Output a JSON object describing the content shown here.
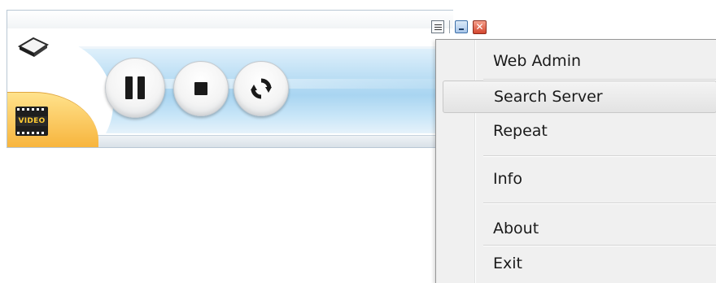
{
  "player": {
    "video_badge": "VIDEO",
    "controls": {
      "pause_icon": "pause-icon",
      "stop_icon": "stop-icon",
      "repeat_icon": "refresh-icon"
    },
    "window_icons": [
      "menu-icon",
      "minimize-icon",
      "close-icon"
    ],
    "close_glyph": "✕"
  },
  "context_menu": {
    "items": [
      {
        "label": "Web Admin",
        "highlighted": false
      },
      {
        "label": "Search Server",
        "highlighted": true
      },
      {
        "label": "Repeat",
        "highlighted": false
      },
      {
        "label": "Info",
        "highlighted": false
      },
      {
        "label": "About",
        "highlighted": false
      },
      {
        "label": "Exit",
        "highlighted": false
      }
    ]
  },
  "colors": {
    "accent_blue": "#a9d5f1",
    "video_tab_orange": "#f7b43c",
    "close_red": "#d3462e",
    "menu_background": "#f0f0f0"
  }
}
